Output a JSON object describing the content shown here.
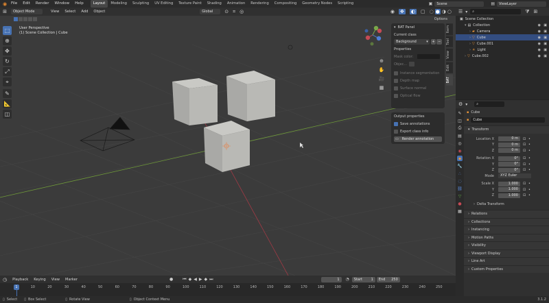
{
  "menubar": {
    "menus": [
      "File",
      "Edit",
      "Render",
      "Window",
      "Help"
    ],
    "workspaces": [
      "Layout",
      "Modeling",
      "Sculpting",
      "UV Editing",
      "Texture Paint",
      "Shading",
      "Animation",
      "Rendering",
      "Compositing",
      "Geometry Nodes",
      "Scripting"
    ],
    "active_workspace": "Layout",
    "scene": "Scene",
    "view_layer": "ViewLayer"
  },
  "viewport_header": {
    "mode": "Object Mode",
    "menus": [
      "View",
      "Select",
      "Add",
      "Object"
    ],
    "transform_orientation": "Global",
    "options_label": "Options"
  },
  "viewport": {
    "perspective_label": "User Perspective",
    "collection_label": "(1) Scene Collection | Cube"
  },
  "bat_panel": {
    "title": "BAT Panel",
    "current_class_label": "Current class",
    "current_class_value": "Background",
    "properties_label": "Properties",
    "mask_color_label": "Mask color:",
    "object_label": "Objec...",
    "checkboxes": [
      {
        "label": "Instance segmentation",
        "checked": false
      },
      {
        "label": "Depth map",
        "checked": false
      },
      {
        "label": "Surface normal",
        "checked": false
      },
      {
        "label": "Optical flow",
        "checked": false
      }
    ]
  },
  "output_panel": {
    "title": "Output properties",
    "save_annotations": "Save annotations",
    "export_class_info": "Export class info",
    "render_button": "Render annotation"
  },
  "sidebar_tabs": [
    "Item",
    "Tool",
    "View",
    "Edit",
    "BAT"
  ],
  "outliner": {
    "root": "Scene Collection",
    "items": [
      {
        "name": "Collection",
        "indent": 1,
        "color": "#e0e0e0",
        "icon": "collection-icon"
      },
      {
        "name": "Camera",
        "indent": 2,
        "color": "#e0e0e0",
        "icon": "camera-icon"
      },
      {
        "name": "Cube",
        "indent": 2,
        "color": "#e0e0e0",
        "icon": "cube-icon",
        "selected": true
      },
      {
        "name": "Cube.001",
        "indent": 2,
        "color": "#e0e0e0",
        "icon": "cube-icon"
      },
      {
        "name": "Light",
        "indent": 2,
        "color": "#e0e0e0",
        "icon": "light-icon"
      },
      {
        "name": "Cube.002",
        "indent": 1,
        "color": "#e0e0e0",
        "icon": "cube-icon"
      }
    ]
  },
  "properties": {
    "object_name": "Cube",
    "object_field": "Cube",
    "transform_label": "Transform",
    "location_label": "Location X",
    "location": [
      "0 m",
      "0 m",
      "0 m"
    ],
    "rotation_label": "Rotation X",
    "rotation": [
      "0°",
      "0°",
      "0°"
    ],
    "mode_label": "Mode",
    "mode_value": "XYZ Euler",
    "scale_label": "Scale X",
    "scale": [
      "1.000",
      "1.000",
      "1.000"
    ],
    "axis_y": "Y",
    "axis_z": "Z",
    "delta_transform": "Delta Transform",
    "sections": [
      "Relations",
      "Collections",
      "Instancing",
      "Motion Paths",
      "Visibility",
      "Viewport Display",
      "Line Art",
      "Custom Properties"
    ]
  },
  "timeline": {
    "menus": [
      "Playback",
      "Keying",
      "View",
      "Marker"
    ],
    "current_frame": "1",
    "start_label": "Start",
    "start": "1",
    "end_label": "End",
    "end": "250",
    "ticks": [
      "0",
      "10",
      "20",
      "30",
      "40",
      "50",
      "60",
      "70",
      "80",
      "90",
      "100",
      "110",
      "120",
      "130",
      "140",
      "150",
      "160",
      "170",
      "180",
      "190",
      "200",
      "210",
      "220",
      "230",
      "240",
      "250"
    ]
  },
  "statusbar": {
    "items": [
      "Select",
      "Box Select",
      "Rotate View",
      "Object Context Menu"
    ],
    "version": "3.1.2"
  }
}
